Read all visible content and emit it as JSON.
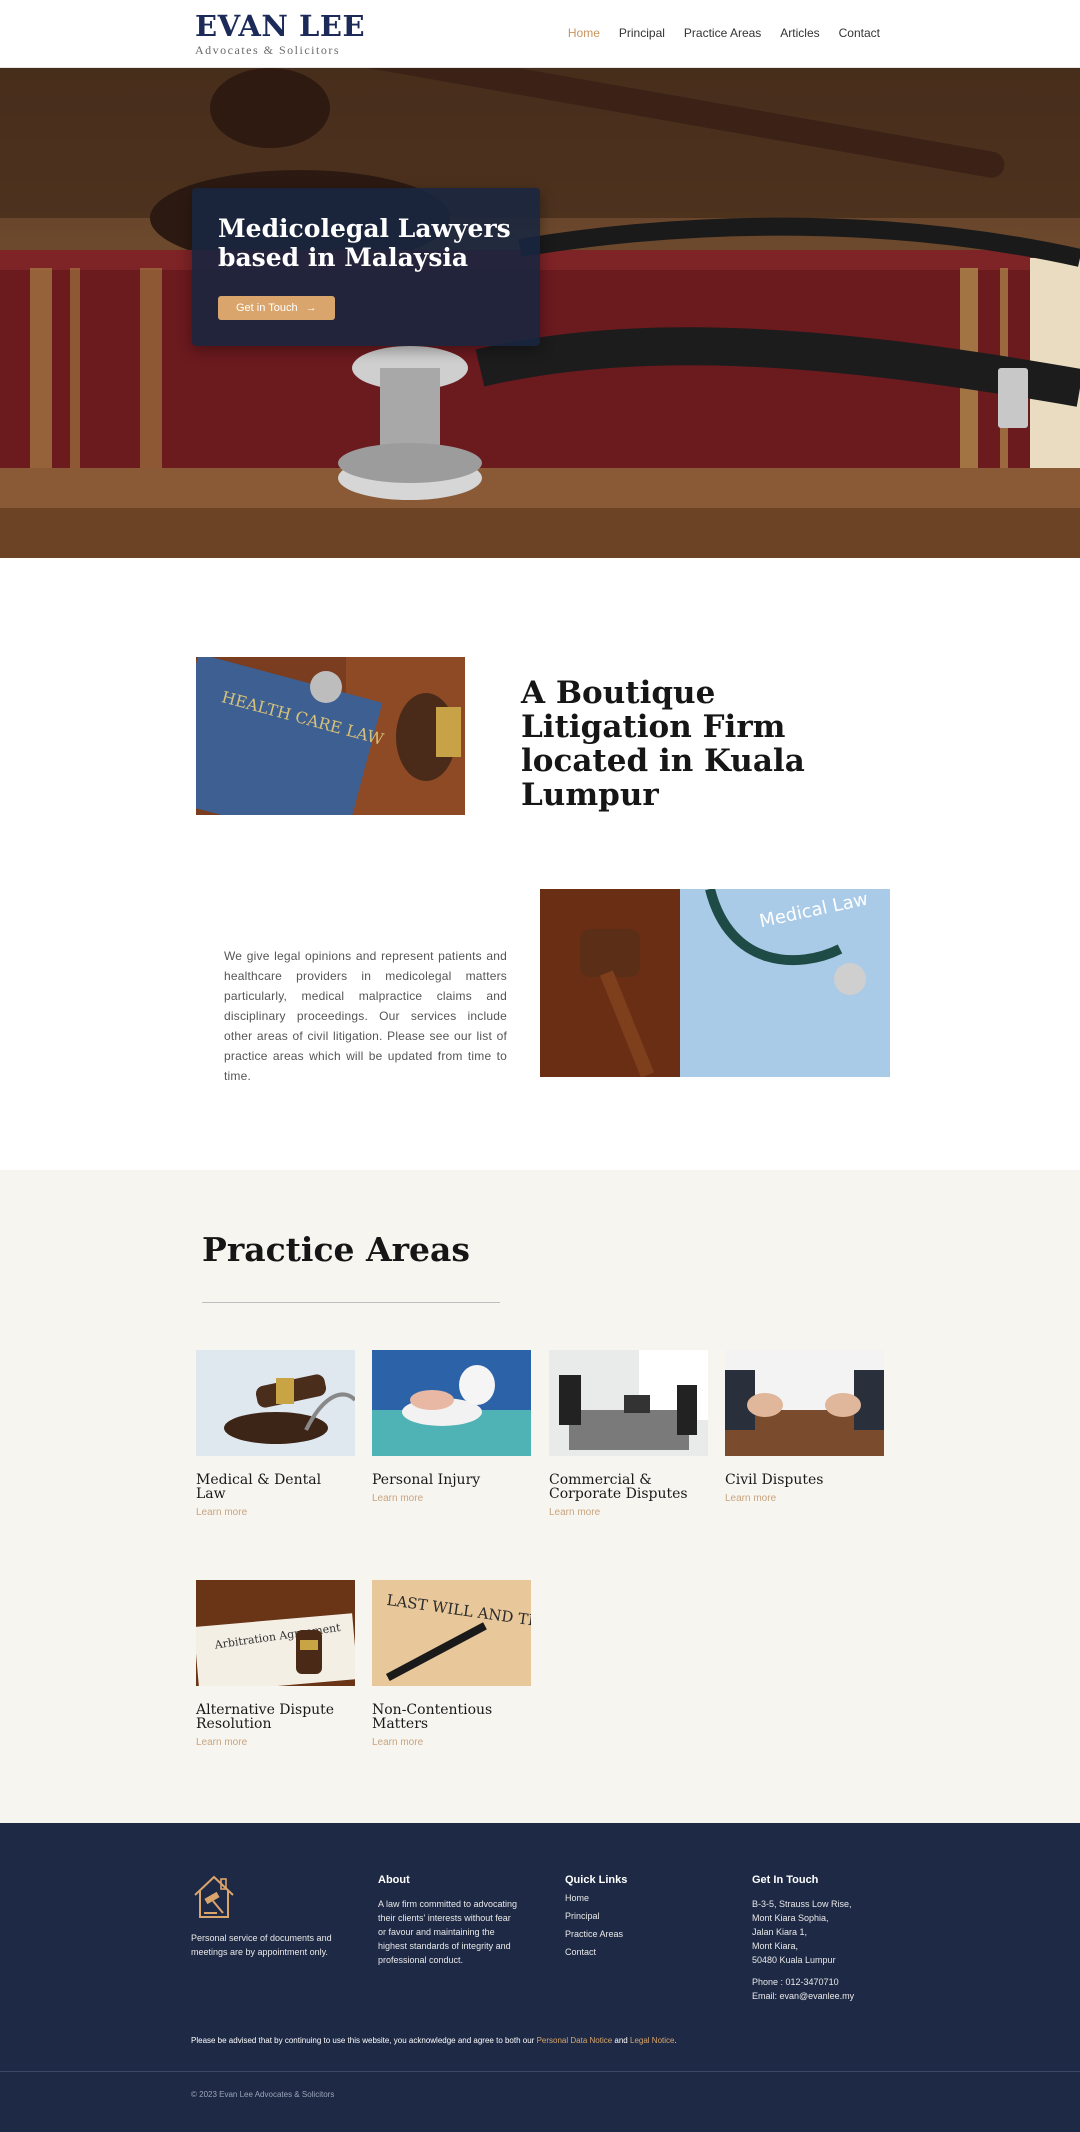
{
  "brand": {
    "name": "EVAN LEE",
    "tagline": "Advocates & Solicitors"
  },
  "nav": {
    "items": [
      "Home",
      "Principal",
      "Practice Areas",
      "Articles",
      "Contact"
    ],
    "active": "Home"
  },
  "hero": {
    "title": "Medicolegal Lawyers based in Malaysia",
    "cta": "Get in Touch"
  },
  "about": {
    "title": "A Boutique Litigation Firm located in Kuala Lumpur",
    "body": "We give legal opinions and represent patients and healthcare providers in medicolegal matters particularly, medical malpractice claims and disciplinary proceedings. Our services include other areas of civil litigation. Please see our list of practice areas which will be updated from time to time.",
    "image1_text": "HEALTH CARE LAW",
    "image2_text": "Medical Law"
  },
  "practice": {
    "title": "Practice Areas",
    "link_label": "Learn more",
    "items": [
      {
        "title": "Medical & Dental Law"
      },
      {
        "title": "Personal Injury"
      },
      {
        "title": "Commercial & Corporate Disputes"
      },
      {
        "title": "Civil Disputes"
      },
      {
        "title": "Alternative Dispute Resolution",
        "image_text": "Arbitration Agreement"
      },
      {
        "title": "Non-Contentious Matters",
        "image_text": "LAST WILL AND TESTAMENT"
      }
    ]
  },
  "footer": {
    "intro": "Personal service of documents and meetings are by appointment only.",
    "about_head": "About",
    "about_text": "A law firm committed to advocating their clients' interests without fear or favour and maintaining the highest standards of integrity and professional conduct.",
    "links_head": "Quick Links",
    "links": [
      "Home",
      "Principal",
      "Practice Areas",
      "Contact"
    ],
    "contact_head": "Get In Touch",
    "address": [
      "B-3-5, Strauss Low Rise,",
      "Mont Kiara Sophia,",
      "Jalan Kiara 1,",
      "Mont Kiara,",
      "50480 Kuala Lumpur"
    ],
    "phone": "Phone : 012-3470710",
    "email": "Email: evan@evanlee.my",
    "note_prefix": "Please be advised that by continuing to use this website, you acknowledge and agree to both our",
    "note_link1": "Personal Data Notice",
    "note_and": "and",
    "note_link2": "Legal Notice",
    "note_suffix": ".",
    "copyright": "© 2023 Evan Lee Advocates & Solicitors"
  },
  "colors": {
    "navy": "#1e2a45",
    "gold": "#d9a56c",
    "brand": "#1c2a5a"
  }
}
